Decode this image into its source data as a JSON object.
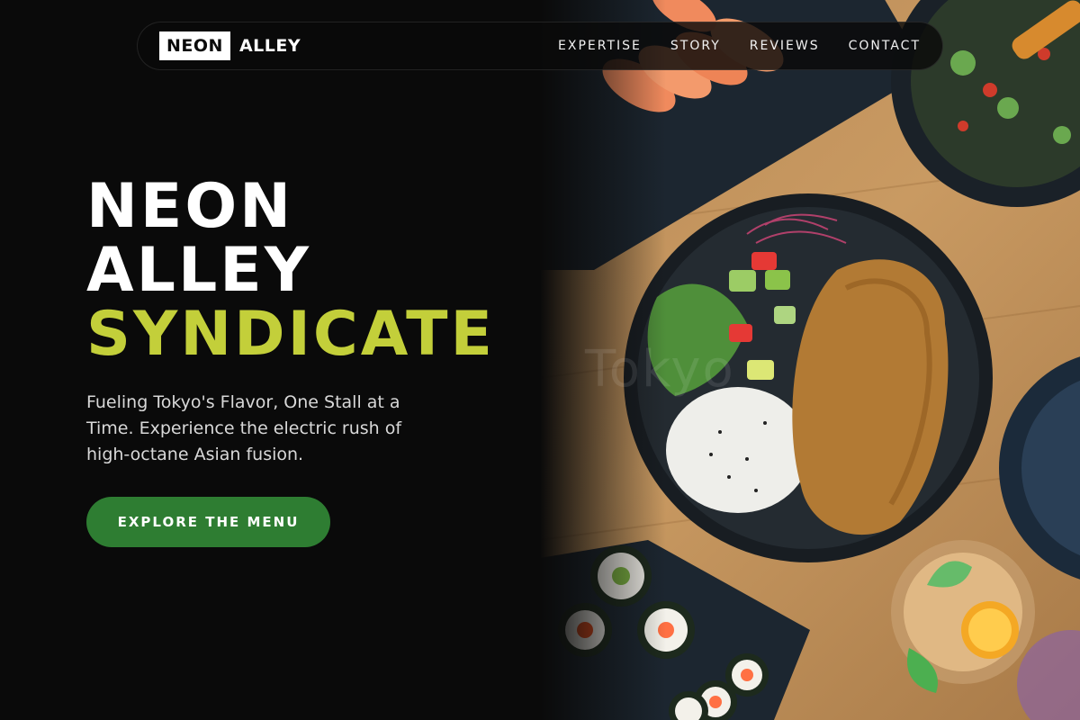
{
  "brand": {
    "logo_box": "NEON",
    "logo_text": "ALLEY"
  },
  "nav": {
    "items": [
      {
        "label": "EXPERTISE"
      },
      {
        "label": "STORY"
      },
      {
        "label": "REVIEWS"
      },
      {
        "label": "CONTACT"
      }
    ]
  },
  "hero": {
    "title_line_1": "NEON",
    "title_line_2": "ALLEY",
    "title_line_3": "SYNDICATE",
    "subtitle": "Fueling Tokyo's Flavor, One Stall at a Time. Experience the electric rush of high-octane Asian fusion.",
    "cta_label": "EXPLORE THE MENU"
  },
  "photo": {
    "watermark": "Tokyo"
  },
  "colors": {
    "background": "#0a0a0a",
    "accent": "#c3cf3a",
    "cta": "#2e7d32",
    "text": "#ffffff"
  }
}
